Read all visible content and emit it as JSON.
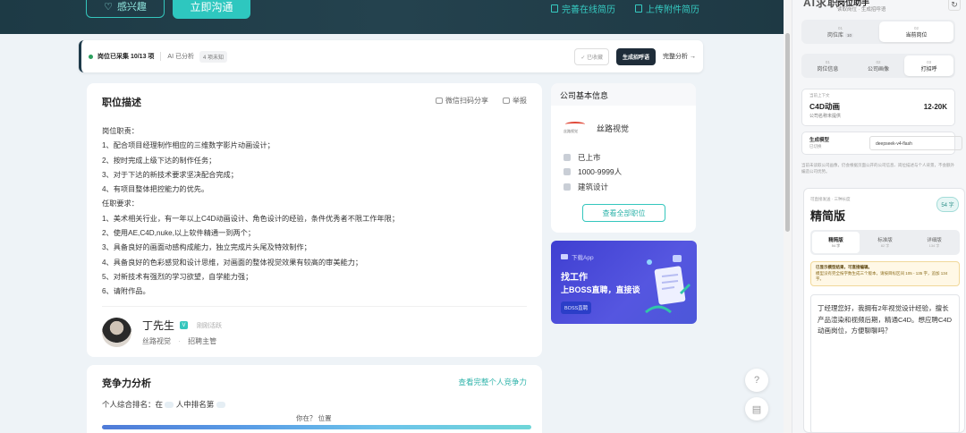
{
  "header": {
    "interest_label": "感兴趣",
    "chat_label": "立即沟通",
    "complete_resume_label": "完善在线简历",
    "upload_resume_label": "上传附件简历"
  },
  "status_strip": {
    "collected": "岗位已采集 10/13 项",
    "ai_status": "AI 已分析",
    "pending": "4 项未知",
    "fav_label": "✓ 已收藏",
    "generate_label": "生成招呼语",
    "full_analysis_label": "完整分析 →"
  },
  "job_description": {
    "title": "职位描述",
    "share_label": "微信扫码分享",
    "report_label": "举报",
    "lines": [
      "岗位职责：",
      "1、配合项目经理制作相应的三维数字影片动画设计；",
      "2、按时完成上级下达的制作任务；",
      "3、对于下达的新技术要求坚决配合完成；",
      "4、有项目整体把控能力的优先。",
      "任职要求：",
      "1、美术相关行业，有一年以上C4D动画设计、角色设计的经验，条件优秀者不限工作年限；",
      "2、使用AE,C4D,nuke,以上软件精通一到两个；",
      "3、具备良好的画面动感构成能力，独立完成片头尾及特效制作；",
      "4、具备良好的色彩感觉和设计思维，对画面的整体视觉效果有较高的审美能力；",
      "5、对新技术有强烈的学习欲望，自学能力强；",
      "6、请附作品。"
    ],
    "recruiter": {
      "name": "丁先生",
      "badge": "V",
      "status": "刚刚活跃",
      "company": "丝路视觉",
      "dot": "·",
      "role": "招聘主管"
    }
  },
  "competitiveness": {
    "title": "竞争力分析",
    "link": "查看完整个人竞争力",
    "rank_prefix": "个人综合排名：在",
    "rank_mid": "人中排名第",
    "where_label": "你在？ 位置"
  },
  "company": {
    "header": "公司基本信息",
    "logo_text": "丝路视觉",
    "name": "丝路视觉",
    "listing": "已上市",
    "size": "1000-9999人",
    "industry": "建筑设计",
    "all_jobs_label": "查看全部职位"
  },
  "ad": {
    "download": "下载App",
    "line1": "找工作",
    "line2": "上BOSS直聘，直接谈",
    "button": "BOSS直聘"
  },
  "float": {
    "help": "?",
    "feedback": "▤"
  },
  "panel": {
    "logo": "AI求职",
    "title": "岗位助手",
    "subtitle": "读取岗位 · 生成招呼语",
    "refresh": "↻",
    "tabs_top": [
      {
        "num": "01",
        "label": "岗位库",
        "badge": "10",
        "active": false
      },
      {
        "num": "02",
        "label": "当前岗位",
        "badge": "",
        "active": true
      }
    ],
    "tabs_steps": [
      {
        "num": "01",
        "label": "岗位信息",
        "active": false
      },
      {
        "num": "02",
        "label": "公司画像",
        "active": false
      },
      {
        "num": "03",
        "label": "打招呼",
        "active": true
      }
    ],
    "position": {
      "label": "当前上下文",
      "name": "C4D动画",
      "company": "公司名称未提供",
      "salary": "12-20K"
    },
    "model": {
      "label": "生成模型",
      "sub": "已切换",
      "value": "deepseek-v4-flash"
    },
    "note": "当前未读取公司画像，仍会根据页面公开的公司信息、岗位描述与个人背景，不会额外编造公司优势。",
    "generated": {
      "pre": "可直接发送 · 三种长度",
      "version": "精简版",
      "words": "54 字",
      "versions": [
        {
          "label": "精简版",
          "count": "54 字",
          "active": true
        },
        {
          "label": "标准版",
          "count": "82 字",
          "active": false
        },
        {
          "label": "详细版",
          "count": "134 字",
          "active": false
        }
      ],
      "warn_title": "已显示模型结果，可直接编辑。",
      "warn_body": "模型没有完全按字数生成三个版本，请按目标区间 105 - 135 字，追加 134 字。",
      "message": "丁经理您好，我拥有2年视觉设计经验，擅长产品渲染和视频后期，精通C4D。想应聘C4D动画岗位，方便聊聊吗？"
    }
  }
}
